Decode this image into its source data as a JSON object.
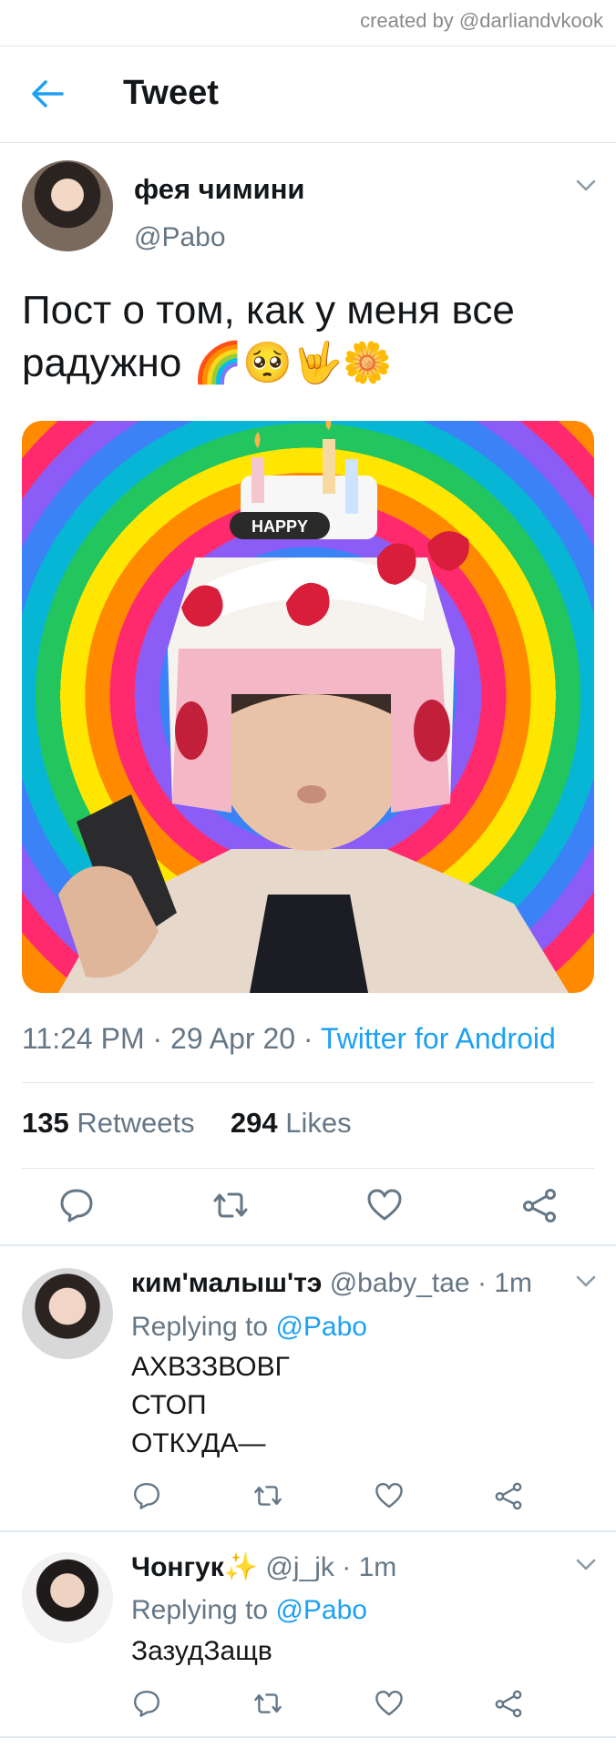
{
  "watermark": "created by @darliandvkook",
  "header": {
    "title": "Tweet",
    "back_icon": "arrow-left-icon"
  },
  "tweet": {
    "author_name": "фея чимини",
    "author_handle": "@Pabo",
    "text": "Пост о том, как у меня все радужно 🌈🥺🤟🌼",
    "media_alt": "HAPPY",
    "time": "11:24 PM",
    "date": "29 Apr 20",
    "source": "Twitter for Android",
    "retweets": "135",
    "retweets_label": "Retweets",
    "likes": "294",
    "likes_label": "Likes"
  },
  "replies": [
    {
      "author_name": "ким'малыш'тэ",
      "author_handle": "@baby_tae",
      "time": "1m",
      "replying_to_label": "Replying to",
      "replying_to": "@Pabo",
      "lines": [
        "АХВЗЗВОВГ",
        "СТОП",
        "ОТКУДА—"
      ]
    },
    {
      "author_name": "Чонгук✨",
      "author_handle": "@j_jk",
      "time": "1m",
      "replying_to_label": "Replying to",
      "replying_to": "@Pabo",
      "lines": [
        "ЗазудЗащв"
      ]
    }
  ],
  "colors": {
    "accent": "#1da1f2",
    "text": "#14171a",
    "muted": "#657786",
    "border": "#e1e8ed"
  }
}
